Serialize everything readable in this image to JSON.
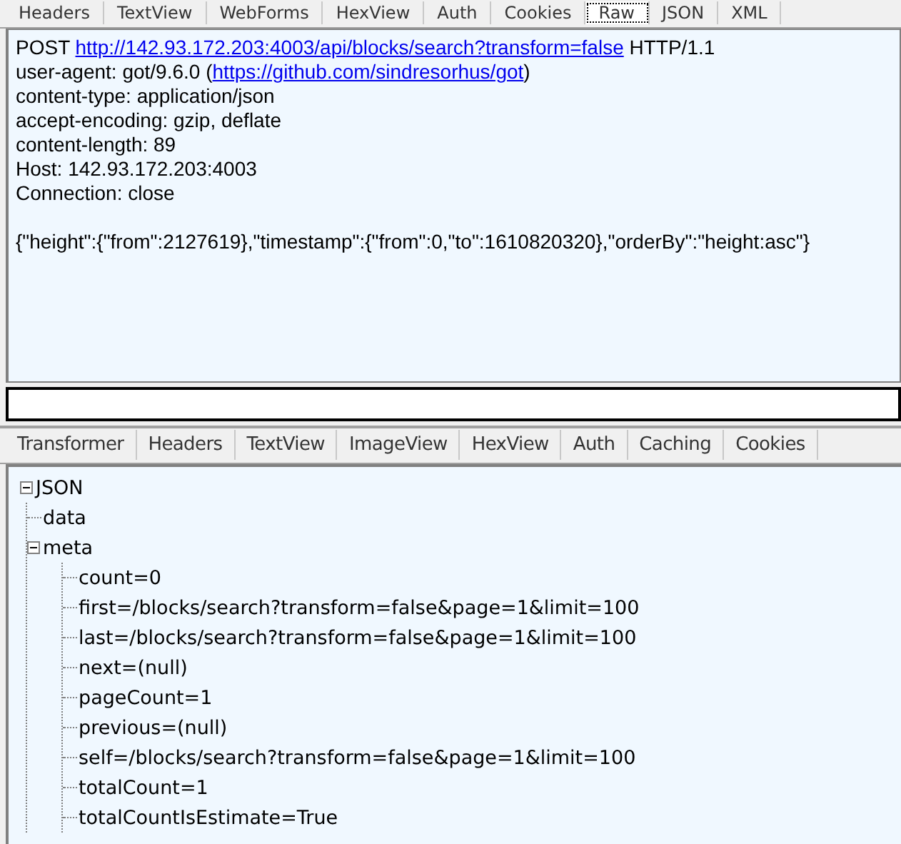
{
  "request_tabs": [
    {
      "label": "Headers",
      "selected": false
    },
    {
      "label": "TextView",
      "selected": false
    },
    {
      "label": "WebForms",
      "selected": false
    },
    {
      "label": "HexView",
      "selected": false
    },
    {
      "label": "Auth",
      "selected": false
    },
    {
      "label": "Cookies",
      "selected": false
    },
    {
      "label": "Raw",
      "selected": true
    },
    {
      "label": "JSON",
      "selected": false
    },
    {
      "label": "XML",
      "selected": false
    }
  ],
  "request_lines": [
    {
      "parts": [
        {
          "kind": "text",
          "text": "POST "
        },
        {
          "kind": "link",
          "text": "http://142.93.172.203:4003/api/blocks/search?transform=false"
        },
        {
          "kind": "text",
          "text": " HTTP/1.1"
        }
      ]
    },
    {
      "parts": [
        {
          "kind": "text",
          "text": "user-agent: got/9.6.0 ("
        },
        {
          "kind": "link",
          "text": "https://github.com/sindresorhus/got"
        },
        {
          "kind": "text",
          "text": ")"
        }
      ]
    },
    {
      "parts": [
        {
          "kind": "text",
          "text": "content-type: application/json"
        }
      ]
    },
    {
      "parts": [
        {
          "kind": "text",
          "text": "accept-encoding: gzip, deflate"
        }
      ]
    },
    {
      "parts": [
        {
          "kind": "text",
          "text": "content-length: 89"
        }
      ]
    },
    {
      "parts": [
        {
          "kind": "text",
          "text": "Host: 142.93.172.203:4003"
        }
      ]
    },
    {
      "parts": [
        {
          "kind": "text",
          "text": "Connection: close"
        }
      ]
    }
  ],
  "request_body": "{\"height\":{\"from\":2127619},\"timestamp\":{\"from\":0,\"to\":1610820320},\"orderBy\":\"height:asc\"}",
  "response_tabs": [
    {
      "label": "Transformer",
      "selected": false
    },
    {
      "label": "Headers",
      "selected": false
    },
    {
      "label": "TextView",
      "selected": false
    },
    {
      "label": "ImageView",
      "selected": false
    },
    {
      "label": "HexView",
      "selected": false
    },
    {
      "label": "Auth",
      "selected": false
    },
    {
      "label": "Caching",
      "selected": false
    },
    {
      "label": "Cookies",
      "selected": false
    }
  ],
  "tree": [
    {
      "label": "JSON",
      "expanded": true,
      "children": [
        {
          "label": "data"
        },
        {
          "label": "meta",
          "expanded": true,
          "children": [
            {
              "label": "count=0"
            },
            {
              "label": "first=/blocks/search?transform=false&page=1&limit=100"
            },
            {
              "label": "last=/blocks/search?transform=false&page=1&limit=100"
            },
            {
              "label": "next=(null)"
            },
            {
              "label": "pageCount=1"
            },
            {
              "label": "previous=(null)"
            },
            {
              "label": "self=/blocks/search?transform=false&page=1&limit=100"
            },
            {
              "label": "totalCount=1"
            },
            {
              "label": "totalCountIsEstimate=True"
            }
          ]
        }
      ]
    }
  ]
}
